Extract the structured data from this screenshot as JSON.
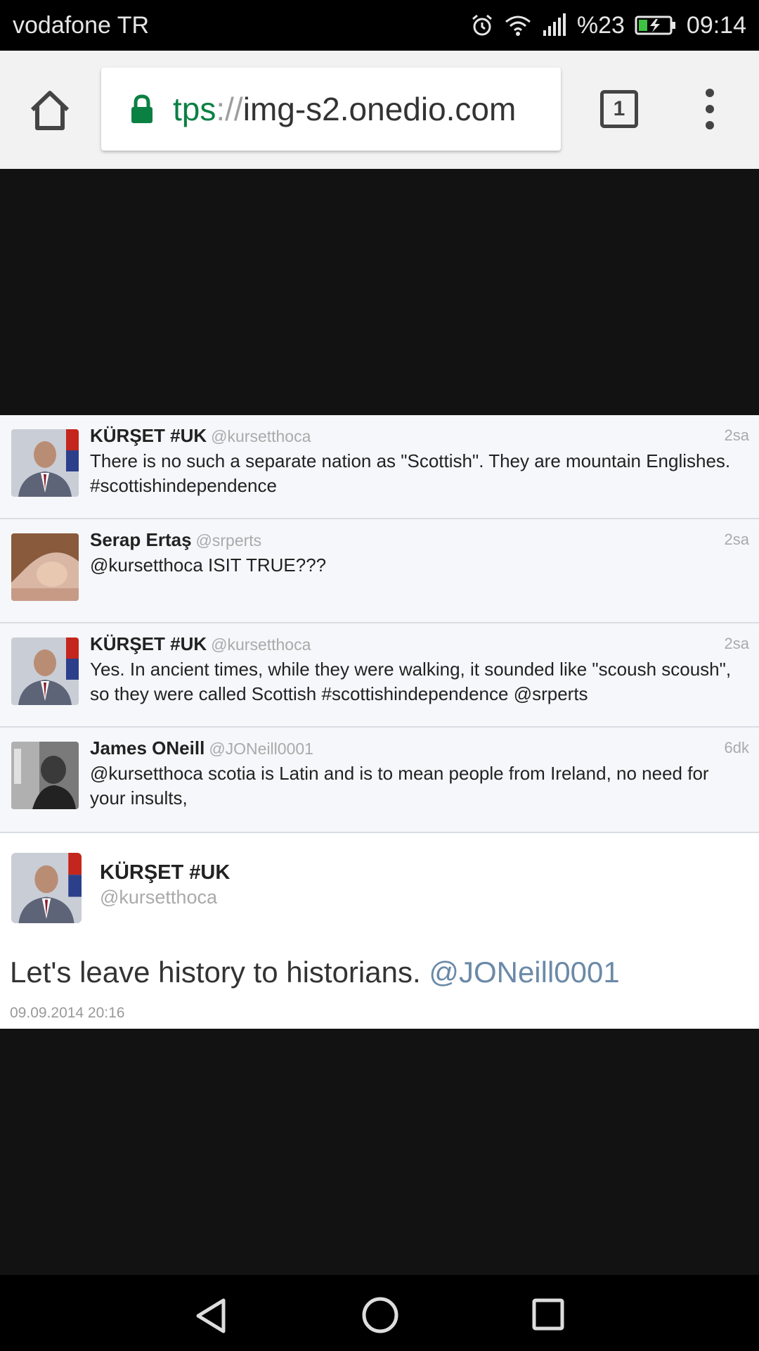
{
  "status_bar": {
    "carrier": "vodafone TR",
    "battery_percent": "%23",
    "time": "09:14"
  },
  "browser": {
    "url_scheme": "tps",
    "url_separator": "://",
    "url_host": "img-s2.onedio.com",
    "tab_count": "1",
    "secure_color": "#0b8043"
  },
  "tweets": [
    {
      "name": "KÜRŞET #UK",
      "handle": "@kursetthoca",
      "time": "2sa",
      "text": "There is no such a separate nation as \"Scottish\". They are mountain Englishes.  #scottishindependence",
      "avatar": "man-suit-avatar"
    },
    {
      "name": "Serap Ertaş",
      "handle": "@srperts",
      "time": "2sa",
      "text": "@kursetthoca ISIT TRUE???",
      "avatar": "woman-avatar"
    },
    {
      "name": "KÜRŞET #UK",
      "handle": "@kursetthoca",
      "time": "2sa",
      "text": "Yes. In ancient times, while they were walking, it sounded like \"scoush scoush\", so they were called Scottish #scottishindependence @srperts",
      "avatar": "man-suit-avatar"
    },
    {
      "name": "James ONeill",
      "handle": "@JONeill0001",
      "time": "6dk",
      "text": "@kursetthoca scotia is Latin and is to mean people from Ireland, no need for your insults,",
      "avatar": "bw-photo-avatar"
    }
  ],
  "main_tweet": {
    "name": "KÜRŞET #UK",
    "handle": "@kursetthoca",
    "text": "Let's leave history to historians.",
    "mention": "@JONeill0001",
    "date": "09.09.2014 20:16"
  }
}
